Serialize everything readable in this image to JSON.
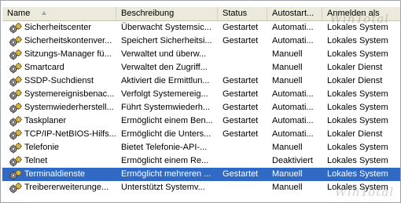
{
  "columns": {
    "name": "Name",
    "description": "Beschreibung",
    "status": "Status",
    "startup": "Autostart...",
    "logon": "Anmelden als"
  },
  "watermark": "WinTotal",
  "rows": [
    {
      "name": "Sicherheitscenter",
      "description": "Überwacht Systemsic...",
      "status": "Gestartet",
      "startup": "Automati...",
      "logon": "Lokales System",
      "selected": false
    },
    {
      "name": "Sicherheitskontenver...",
      "description": "Speichert Sicherheitsi...",
      "status": "Gestartet",
      "startup": "Automati...",
      "logon": "Lokales System",
      "selected": false
    },
    {
      "name": "Sitzungs-Manager fü...",
      "description": "Verwaltet und überw...",
      "status": "",
      "startup": "Manuell",
      "logon": "Lokales System",
      "selected": false
    },
    {
      "name": "Smartcard",
      "description": "Verwaltet den Zugriff...",
      "status": "",
      "startup": "Manuell",
      "logon": "Lokaler Dienst",
      "selected": false
    },
    {
      "name": "SSDP-Suchdienst",
      "description": "Aktiviert die Ermittlun...",
      "status": "Gestartet",
      "startup": "Manuell",
      "logon": "Lokaler Dienst",
      "selected": false
    },
    {
      "name": "Systemereignisbenac...",
      "description": "Verfolgt Systemereig...",
      "status": "Gestartet",
      "startup": "Automati...",
      "logon": "Lokales System",
      "selected": false
    },
    {
      "name": "Systemwiederherstell...",
      "description": "Führt Systemwiederh...",
      "status": "Gestartet",
      "startup": "Automati...",
      "logon": "Lokales System",
      "selected": false
    },
    {
      "name": "Taskplaner",
      "description": "Ermöglicht einem Ben...",
      "status": "Gestartet",
      "startup": "Automati...",
      "logon": "Lokales System",
      "selected": false
    },
    {
      "name": "TCP/IP-NetBIOS-Hilfs...",
      "description": "Ermöglicht die Unters...",
      "status": "Gestartet",
      "startup": "Automati...",
      "logon": "Lokaler Dienst",
      "selected": false
    },
    {
      "name": "Telefonie",
      "description": "Bietet Telefonie-API-...",
      "status": "",
      "startup": "Manuell",
      "logon": "Lokales System",
      "selected": false
    },
    {
      "name": "Telnet",
      "description": "Ermöglicht einem Re...",
      "status": "",
      "startup": "Deaktiviert",
      "logon": "Lokales System",
      "selected": false
    },
    {
      "name": "Terminaldienste",
      "description": "Ermöglicht mehreren ...",
      "status": "Gestartet",
      "startup": "Manuell",
      "logon": "Lokales System",
      "selected": true
    },
    {
      "name": "Treibererweiterunge...",
      "description": "Unterstützt Systemv...",
      "status": "",
      "startup": "Manuell",
      "logon": "Lokales System",
      "selected": false
    }
  ],
  "icons": {
    "service": "service-gears-icon"
  },
  "colors": {
    "selection": "#316ac5",
    "header_bg": "#ebeadb"
  }
}
